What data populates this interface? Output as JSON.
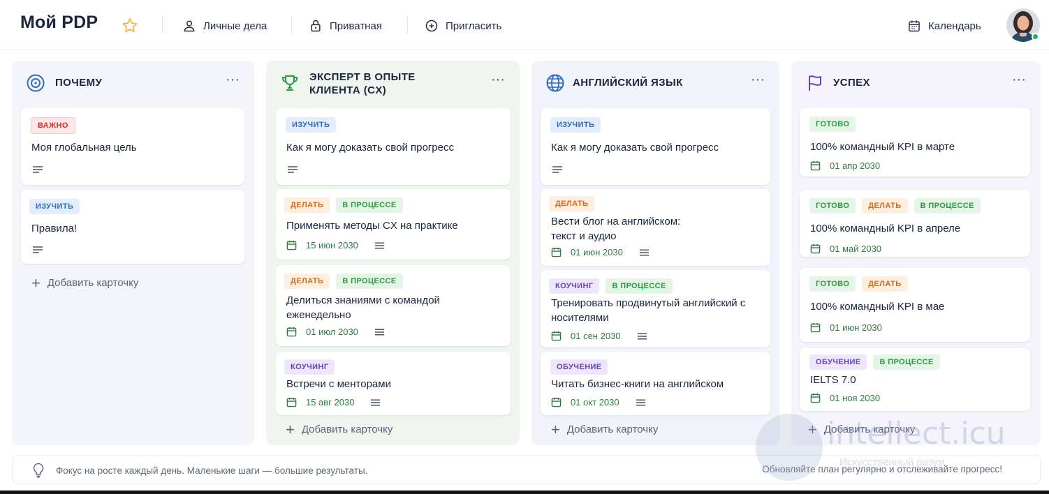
{
  "header": {
    "title": "Мой PDP",
    "buttons": [
      "Личные дела",
      "Приватная",
      "Пригласить"
    ],
    "calendar": "Календарь"
  },
  "columns": [
    {
      "title": "ПОЧЕМУ",
      "icon": "target-icon",
      "add_label": "Добавить карточку",
      "cards": [
        {
          "tags": [
            "ВАЖНО"
          ],
          "title": "Моя глобальная цель"
        },
        {
          "tags": [
            "ИЗУЧИТЬ"
          ],
          "title": "Правила!"
        }
      ]
    },
    {
      "title": "ЭКСПЕРТ В ОПЫТЕ КЛИЕНТА (CX)",
      "icon": "trophy-icon",
      "add_label": "Добавить карточку",
      "cards": [
        {
          "tags": [
            "ИЗУЧИТЬ"
          ],
          "title": "Как я могу доказать свой прогресс"
        },
        {
          "tags": [
            "ДЕЛАТЬ",
            "В ПРОЦЕССЕ"
          ],
          "title": "Применять методы CX на практике",
          "date": "15 июн 2030"
        },
        {
          "tags": [
            "ДЕЛАТЬ",
            "В ПРОЦЕССЕ"
          ],
          "title": "Делиться знаниями с командой еженедельно",
          "date": "01 июл 2030"
        },
        {
          "tags": [
            "КОУЧИНГ"
          ],
          "title": "Встречи с менторами",
          "date": "15 авг 2030"
        }
      ]
    },
    {
      "title": "АНГЛИЙСКИЙ ЯЗЫК",
      "icon": "globe-icon",
      "add_label": "Добавить карточку",
      "cards": [
        {
          "tags": [
            "ИЗУЧИТЬ"
          ],
          "title": "Как я могу доказать свой прогресс"
        },
        {
          "tags": [
            "ДЕЛАТЬ"
          ],
          "title": "Вести блог на английском: текст и аудио",
          "date": "01 июн 2030"
        },
        {
          "tags": [
            "КОУЧИНГ",
            "В ПРОЦЕССЕ"
          ],
          "title": "Тренировать продвинутый английский с носителями",
          "date": "01 сен 2030"
        },
        {
          "tags": [
            "ОБУЧЕНИЕ"
          ],
          "title": "Читать бизнес-книги на английском",
          "date": "01 окт 2030"
        }
      ]
    },
    {
      "title": "УСПЕХ",
      "icon": "flag-icon",
      "add_label": "Добавить карточку",
      "cards": [
        {
          "tags": [
            "ГОТОВО"
          ],
          "title": "100% командный KPI в марте",
          "date": "01 апр 2030"
        },
        {
          "tags": [
            "ГОТОВО",
            "ДЕЛАТЬ",
            "В ПРОЦЕССЕ"
          ],
          "title": "100% командный KPI в апреле",
          "date": "01 май 2030"
        },
        {
          "tags": [
            "ГОТОВО",
            "ДЕЛАТЬ"
          ],
          "title": "100% командный KPI в мае",
          "date": "01 июн 2030"
        },
        {
          "tags": [
            "ОБУЧЕНИЕ",
            "В ПРОЦЕССЕ"
          ],
          "title": "IELTS 7.0",
          "date": "01 ноя 2030"
        }
      ]
    }
  ],
  "footer": {
    "left": "Фокус на росте каждый день. Маленькие шаги — большие результаты.",
    "right": "Обновляйте план регулярно и отслеживайте прогресс!"
  },
  "watermark": {
    "main": "intellect.icu",
    "sub": "Искусственный разум"
  },
  "colors": {
    "col1_bg": "#f3f5fa",
    "col2_bg": "#f0f6ef",
    "col3_bg": "#f1f4fb",
    "col4_bg": "#f5f3fc",
    "date_green": "#2f7a40",
    "accent_blue": "#2f6bc2",
    "star": "#f2b33d"
  }
}
